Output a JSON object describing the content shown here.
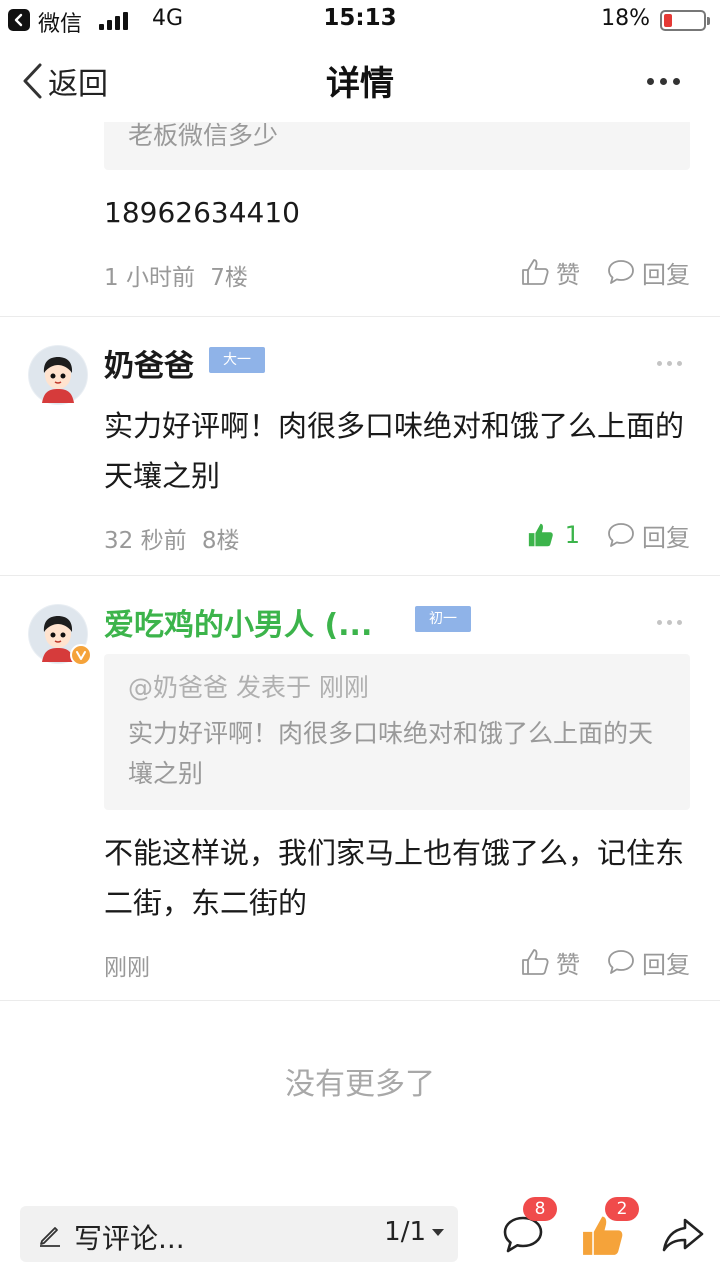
{
  "status_bar": {
    "app": "微信",
    "network": "4G",
    "time": "15:13",
    "battery": "18%"
  },
  "nav": {
    "back_label": "返回",
    "title": "详情"
  },
  "previous_comment": {
    "quote_text": "老板微信多少",
    "body": "18962634410",
    "time": "1 小时前",
    "floor": "7楼",
    "like_label": "赞",
    "reply_label": "回复"
  },
  "comments": [
    {
      "username": "奶爸爸",
      "level": "大一",
      "body": "实力好评啊！肉很多口味绝对和饿了么上面的天壤之别",
      "time": "32 秒前",
      "floor": "8楼",
      "like_count": "1",
      "reply_label": "回复"
    },
    {
      "username": "爱吃鸡的小男人 (...",
      "level": "初一",
      "quote_header": "@奶爸爸 发表于 刚刚",
      "quote_text": "实力好评啊！肉很多口味绝对和饿了么上面的天壤之别",
      "body": "不能这样说，我们家马上也有饿了么，记住东二街，东二街的",
      "time": "刚刚",
      "like_label": "赞",
      "reply_label": "回复"
    }
  ],
  "end_text": "没有更多了",
  "toolbar": {
    "placeholder": "写评论...",
    "pager": "1/1",
    "comment_count": "8",
    "like_count": "2"
  },
  "colors": {
    "accent_green": "#3cb44b",
    "like_orange": "#f5a33a",
    "badge_red": "#f04b4b",
    "level_badge": "#8fb3e8"
  },
  "icons": [
    "back-chevron-icon",
    "more-icon",
    "thumb-up-icon",
    "speech-bubble-icon",
    "pen-icon",
    "share-icon",
    "verified-icon"
  ]
}
